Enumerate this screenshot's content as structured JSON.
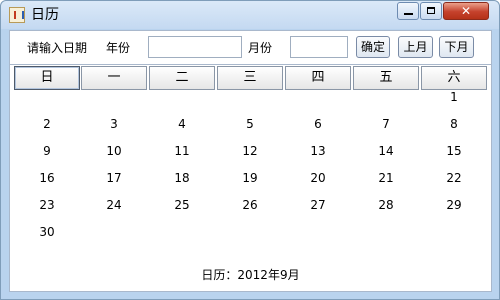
{
  "window": {
    "title": "日历",
    "close_symbol": "✕"
  },
  "toolbar": {
    "prompt_label": "请输入日期",
    "year_label": "年份",
    "year_value": "",
    "month_label": "月份",
    "month_value": "",
    "confirm_label": "确定",
    "prev_label": "上月",
    "next_label": "下月"
  },
  "calendar": {
    "weekday_headers": [
      "日",
      "一",
      "二",
      "三",
      "四",
      "五",
      "六"
    ],
    "rows": [
      [
        "",
        "",
        "",
        "",
        "",
        "",
        "1"
      ],
      [
        "2",
        "3",
        "4",
        "5",
        "6",
        "7",
        "8"
      ],
      [
        "9",
        "10",
        "11",
        "12",
        "13",
        "14",
        "15"
      ],
      [
        "16",
        "17",
        "18",
        "19",
        "20",
        "21",
        "22"
      ],
      [
        "23",
        "24",
        "25",
        "26",
        "27",
        "28",
        "29"
      ],
      [
        "30",
        "",
        "",
        "",
        "",
        "",
        ""
      ]
    ]
  },
  "footer": {
    "text": "日历：2012年9月"
  }
}
